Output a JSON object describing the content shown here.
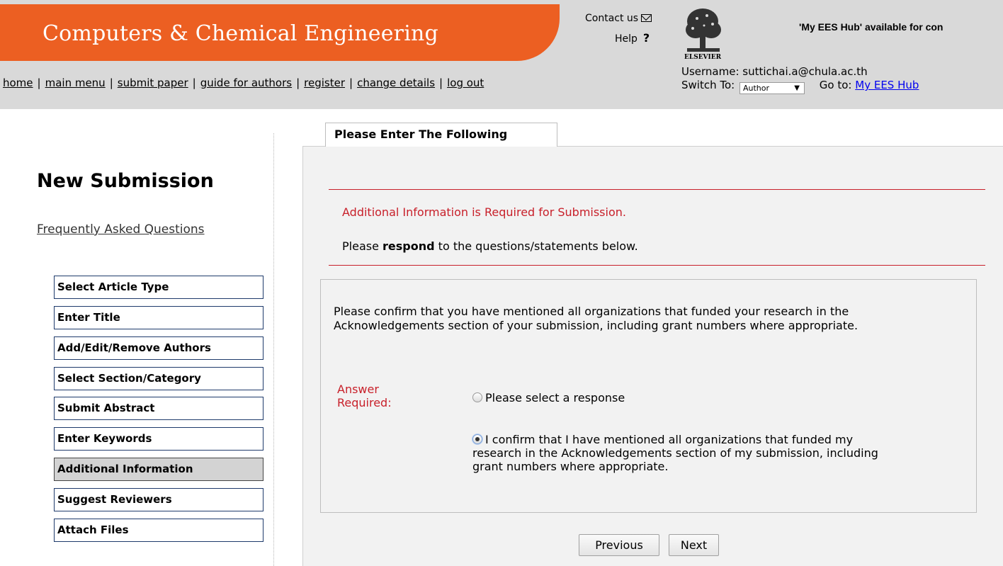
{
  "header": {
    "journal_title": "Computers & Chemical Engineering",
    "contact_label": "Contact us",
    "help_label": "Help",
    "hub_notice": "'My EES Hub' available for con",
    "username_label": "Username: suttichai.a@chula.ac.th",
    "switch_to_label": "Switch To:",
    "role_value": "Author",
    "goto_label": "Go to:",
    "goto_link": "My EES Hub",
    "elsevier_text": "ELSEVIER",
    "brand_color": "#ec5f22"
  },
  "nav": {
    "items": [
      "home",
      "main menu",
      "submit paper",
      "guide for authors",
      "register",
      "change details",
      "log out"
    ],
    "separator": "|"
  },
  "sidebar": {
    "title": "New Submission",
    "faq": "Frequently Asked Questions",
    "steps": [
      {
        "label": "Select Article Type",
        "active": false
      },
      {
        "label": "Enter Title",
        "active": false
      },
      {
        "label": "Add/Edit/Remove Authors",
        "active": false
      },
      {
        "label": "Select Section/Category",
        "active": false
      },
      {
        "label": "Submit Abstract",
        "active": false
      },
      {
        "label": "Enter Keywords",
        "active": false
      },
      {
        "label": "Additional Information",
        "active": true
      },
      {
        "label": "Suggest Reviewers",
        "active": false
      },
      {
        "label": "Attach Files",
        "active": false
      }
    ]
  },
  "main": {
    "tab_label": "Please Enter The Following",
    "required_message": "Additional Information is Required for Submission.",
    "respond_prefix": "Please ",
    "respond_bold": "respond",
    "respond_suffix": " to the questions/statements below.",
    "question": "Please confirm that you have mentioned all organizations that funded your research in the Acknowledgements section of your submission, including grant numbers where appropriate.",
    "answer_label_line1": "Answer",
    "answer_label_line2": "Required:",
    "option1": "Please select a response",
    "option2": "I confirm that I have mentioned all organizations that funded my research in the Acknowledgements section of my submission, including grant numbers where appropriate.",
    "selected_option": 2,
    "previous_label": "Previous",
    "next_label": "Next",
    "required_color": "#c8202a"
  }
}
